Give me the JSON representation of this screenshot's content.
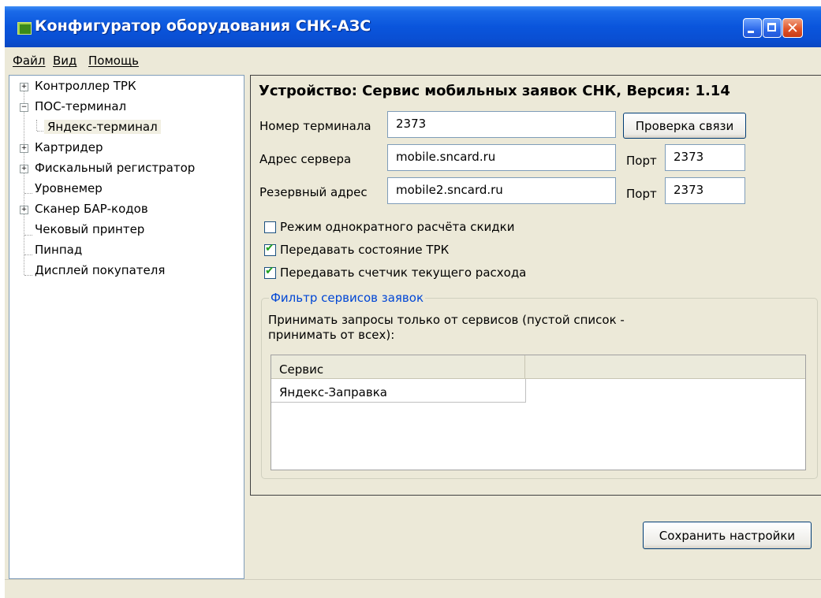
{
  "window": {
    "title": "Конфигуратор оборудования СНК-АЗС"
  },
  "menu": [
    "Файл",
    "Вид",
    "Помощь"
  ],
  "tree": {
    "items": [
      {
        "label": "Контроллер ТРК",
        "expander": "+"
      },
      {
        "label": "ПОС-терминал",
        "expander": "−"
      },
      {
        "label": "Яндекс-терминал",
        "selected": true
      },
      {
        "label": "Картридер",
        "expander": "+"
      },
      {
        "label": "Фискальный регистратор",
        "expander": "+"
      },
      {
        "label": "Уровнемер"
      },
      {
        "label": "Сканер БАР-кодов",
        "expander": "+"
      },
      {
        "label": "Чековый принтер"
      },
      {
        "label": "Пинпад"
      },
      {
        "label": "Дисплей покупателя"
      }
    ]
  },
  "device": {
    "header": "Устройство: Сервис мобильных заявок СНК, Версия: 1.14",
    "terminal_label": "Номер терминала",
    "terminal_value": "2373",
    "check_button": "Проверка связи",
    "server_label": "Адрес сервера",
    "server_value": "mobile.sncard.ru",
    "port_label": "Порт",
    "server_port": "2373",
    "reserve_label": "Резервный адрес",
    "reserve_value": "mobile2.sncard.ru",
    "reserve_port": "2373"
  },
  "options": [
    {
      "label": "Режим однократного расчёта скидки",
      "checked": false
    },
    {
      "label": "Передавать состояние ТРК",
      "checked": true
    },
    {
      "label": "Передавать счетчик текущего расхода",
      "checked": true
    }
  ],
  "filter": {
    "legend": "Фильтр сервисов заявок",
    "description": "Принимать запросы только от сервисов (пустой список - принимать от всех):",
    "column": "Сервис",
    "rows": [
      "Яндекс-Заправка"
    ]
  },
  "save_button": "Сохранить настройки"
}
